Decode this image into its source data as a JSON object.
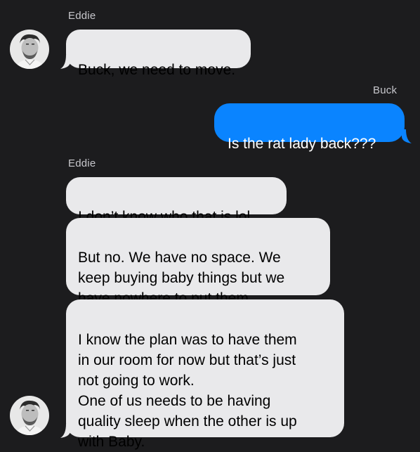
{
  "thread": {
    "messages": [
      {
        "sender": "Eddie",
        "direction": "incoming",
        "text": "Buck, we need to move."
      },
      {
        "sender": "Buck",
        "direction": "outgoing",
        "text": "Is the rat lady back???"
      },
      {
        "sender": "Eddie",
        "direction": "incoming",
        "text": "I don’t know who that is lol"
      },
      {
        "sender": "Eddie",
        "direction": "incoming",
        "text": "But no. We have no space. We\nkeep buying baby things but we\nhave nowhere to put them."
      },
      {
        "sender": "Eddie",
        "direction": "incoming",
        "text": "I know the plan was to have them\nin our room for now but that’s just\nnot going to work.\nOne of us needs to be having\nquality sleep when the other is up\nwith Baby."
      }
    ]
  },
  "colors": {
    "background": "#1c1c1e",
    "incoming_bubble": "#e9e9eb",
    "outgoing_bubble": "#0a84ff",
    "sender_name": "#c7c7cc"
  },
  "icons": {
    "avatar": "avatar-photo-icon"
  }
}
